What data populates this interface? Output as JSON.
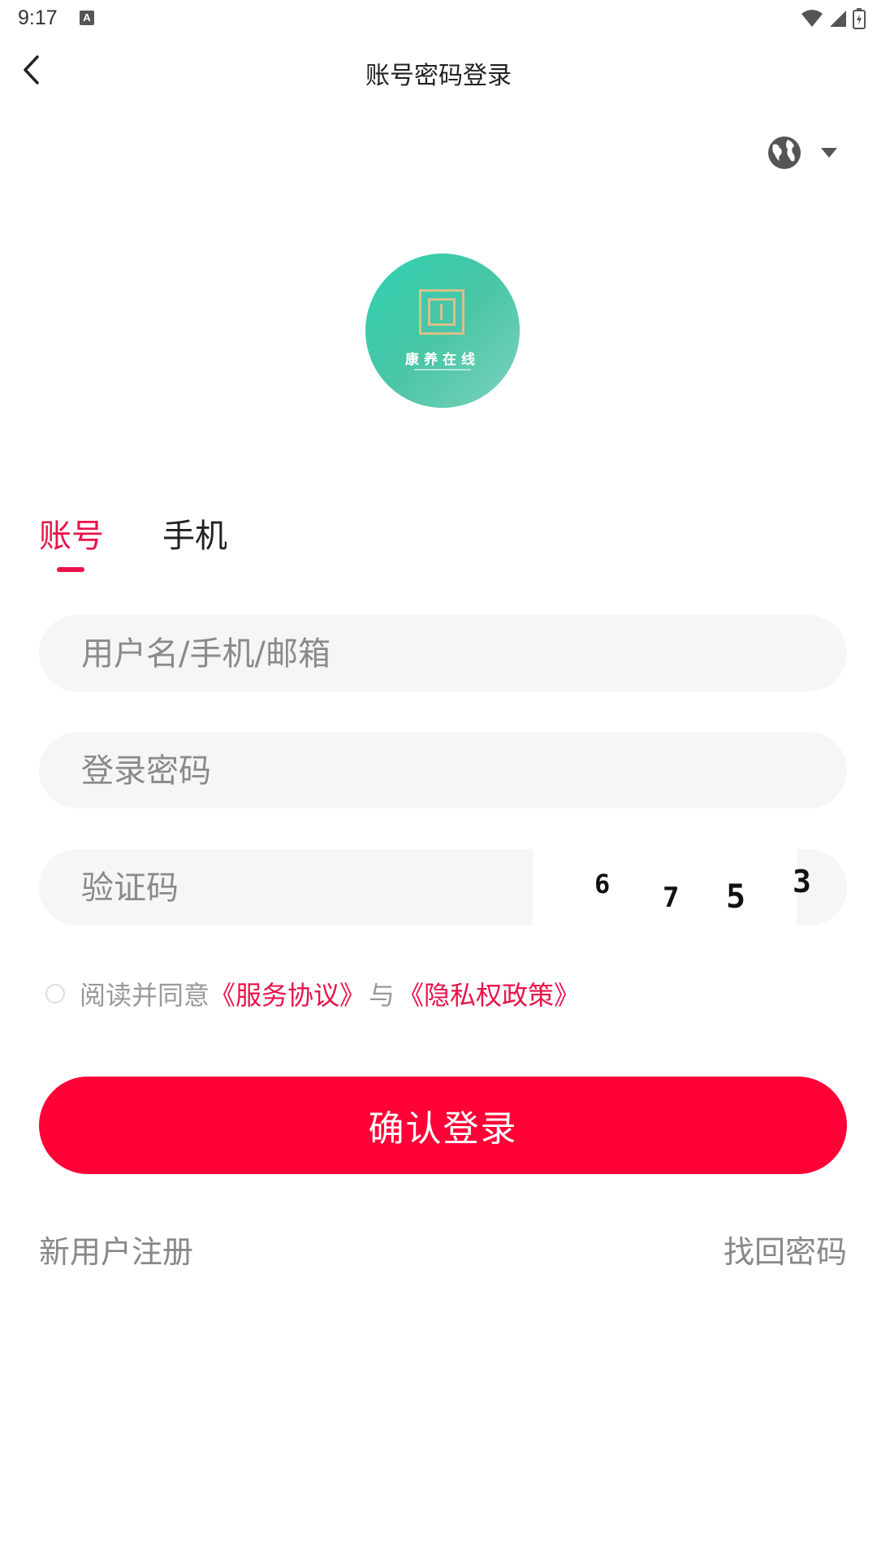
{
  "status_bar": {
    "time": "9:17",
    "notification_icon": "a-letter-icon",
    "icons": [
      "wifi-icon",
      "signal-icon",
      "battery-icon"
    ]
  },
  "nav": {
    "title": "账号密码登录",
    "back_icon": "chevron-left-icon"
  },
  "language": {
    "icon": "globe-icon",
    "dropdown_icon": "caret-down-icon"
  },
  "logo": {
    "text": "康养在线"
  },
  "tabs": [
    {
      "label": "账号",
      "active": true
    },
    {
      "label": "手机",
      "active": false
    }
  ],
  "form": {
    "username_placeholder": "用户名/手机/邮箱",
    "password_placeholder": "登录密码",
    "captcha_placeholder": "验证码",
    "captcha_digits": [
      "6",
      "7",
      "5",
      "3"
    ]
  },
  "agreement": {
    "prefix": "阅读并同意",
    "service_link": "《服务协议》",
    "and": "与",
    "privacy_link": "《隐私权政策》"
  },
  "login_button": "确认登录",
  "links": {
    "register": "新用户注册",
    "forgot_password": "找回密码"
  },
  "colors": {
    "accent": "#e8134a",
    "button": "#ff0037",
    "input_bg": "#f6f6f6",
    "logo_green": "#2fd3b3"
  }
}
